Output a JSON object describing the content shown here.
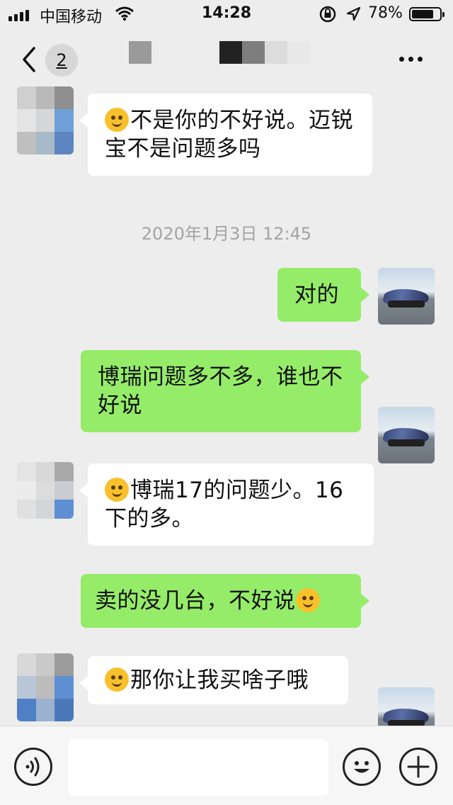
{
  "status_bar": {
    "carrier": "中国移动",
    "time": "14:28",
    "battery_percent": "78%",
    "battery_level": 0.78,
    "icons": [
      "signal-icon",
      "wifi-icon",
      "rotation-lock-icon",
      "location-icon",
      "battery-icon"
    ]
  },
  "nav": {
    "back_icon": "chevron-left-icon",
    "unread_count": "2",
    "more_icon": "more-icon"
  },
  "chat": {
    "timestamp": "2020年1月3日 12:45",
    "messages": [
      {
        "from": "contact",
        "emoji": "facepalm-emoji",
        "text": "不是你的不好说。迈锐宝不是问题多吗"
      },
      {
        "from": "me",
        "text": "对的"
      },
      {
        "from": "me",
        "text": "博瑞问题多不多，谁也不好说"
      },
      {
        "from": "contact",
        "emoji": "pleading-emoji",
        "text": "博瑞17的问题少。16下的多。"
      },
      {
        "from": "me",
        "text": "卖的没几台，不好说",
        "emoji": "facepalm-emoji"
      },
      {
        "from": "contact",
        "emoji": "worried-emoji",
        "text": "那你让我买啥子哦"
      }
    ]
  },
  "input_bar": {
    "voice_icon": "voice-icon",
    "input_value": "",
    "emoji_icon": "smiley-icon",
    "plus_icon": "plus-icon"
  },
  "colors": {
    "background": "#ededed",
    "incoming_bubble": "#ffffff",
    "outgoing_bubble": "#95ec69",
    "timestamp_text": "#a4a4a4"
  }
}
